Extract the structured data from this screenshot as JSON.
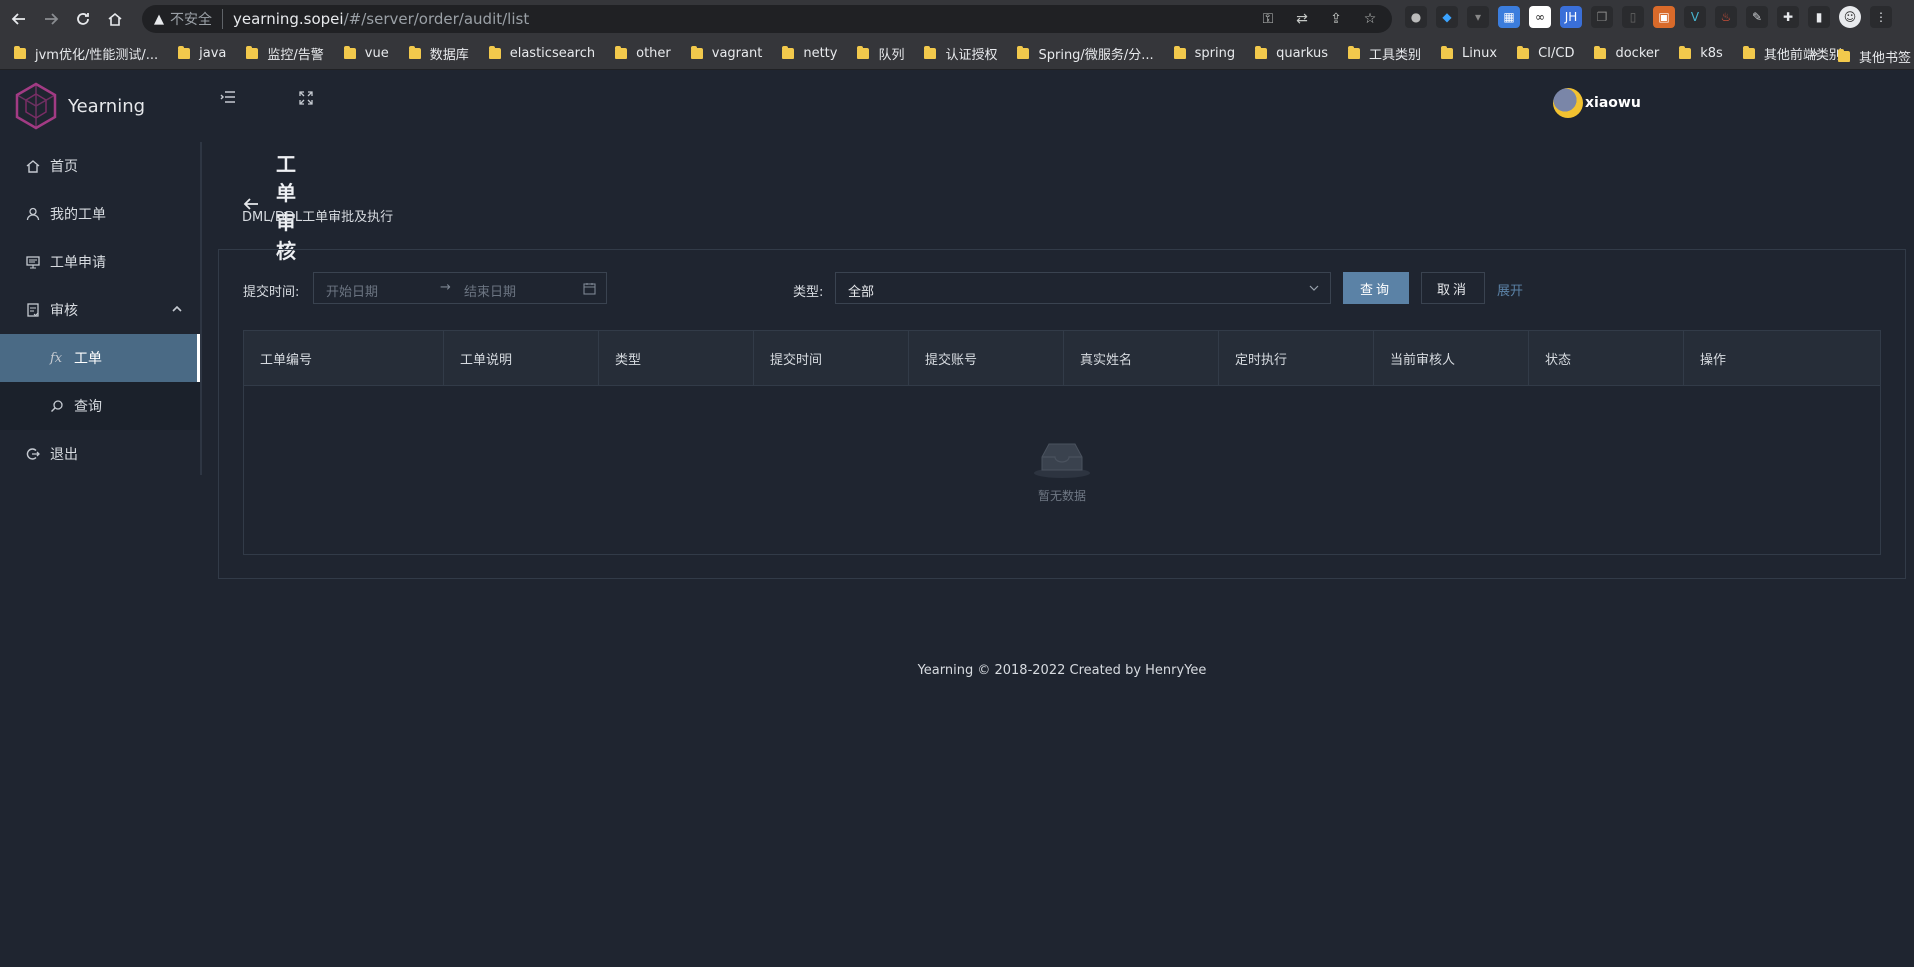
{
  "browser": {
    "security_label": "不安全",
    "url_host": "yearning.sopei",
    "url_path": "/#/server/order/audit/list",
    "bookmarks": [
      "jvm优化/性能测试/...",
      "java",
      "监控/告警",
      "vue",
      "数据库",
      "elasticsearch",
      "other",
      "vagrant",
      "netty",
      "队列",
      "认证授权",
      "Spring/微服务/分...",
      "spring",
      "quarkus",
      "工具类别",
      "Linux",
      "CI/CD",
      "docker",
      "k8s",
      "其他前端类别"
    ],
    "bookmarks_more": "»",
    "other_bookmarks": "其他书签"
  },
  "app": {
    "name": "Yearning",
    "user": "xiaowu"
  },
  "sidebar": {
    "items": [
      {
        "label": "首页",
        "icon": "home-icon"
      },
      {
        "label": "我的工单",
        "icon": "user-icon"
      },
      {
        "label": "工单申请",
        "icon": "monitor-icon"
      },
      {
        "label": "审核",
        "icon": "audit-icon"
      }
    ],
    "sub_items": [
      {
        "label": "工单",
        "icon": "fx-icon"
      },
      {
        "label": "查询",
        "icon": "search-icon"
      }
    ],
    "logout": "退出"
  },
  "page": {
    "title": "工单审核",
    "subtitle": "DML/DDL工单审批及执行"
  },
  "filters": {
    "time_label": "提交时间:",
    "start_placeholder": "开始日期",
    "end_placeholder": "结束日期",
    "type_label": "类型:",
    "type_value": "全部",
    "query_button": "查询",
    "cancel_button": "取消",
    "expand_link": "展开"
  },
  "table": {
    "columns": [
      "工单编号",
      "工单说明",
      "类型",
      "提交时间",
      "提交账号",
      "真实姓名",
      "定时执行",
      "当前审核人",
      "状态",
      "操作"
    ],
    "empty_text": "暂无数据"
  },
  "footer": "Yearning © 2018-2022 Created by HenryYee",
  "colors": {
    "background": "#1f2530",
    "primary": "#5b82a6",
    "active_menu": "#4a6a85"
  }
}
